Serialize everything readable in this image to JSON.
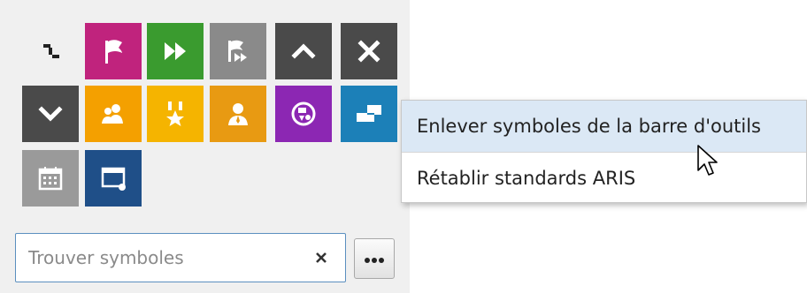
{
  "toolbar": {
    "tiles": [
      {
        "icon": "connector-icon",
        "color": "#f0f0f0"
      },
      {
        "icon": "flag-icon",
        "color": "#c0237d"
      },
      {
        "icon": "fast-forward-icon",
        "color": "#3a9b2f"
      },
      {
        "icon": "flag-forward-icon",
        "color": "#8a8a8a"
      },
      {
        "icon": "chevron-up-icon",
        "color": "#4a4a4a"
      },
      {
        "icon": "close-icon",
        "color": "#4a4a4a"
      },
      {
        "icon": "chevron-down-icon",
        "color": "#4a4a4a"
      },
      {
        "icon": "group-icon",
        "color": "#f4a000"
      },
      {
        "icon": "award-icon",
        "color": "#f5b400"
      },
      {
        "icon": "person-icon",
        "color": "#e89a12"
      },
      {
        "icon": "process-icon",
        "color": "#8c27b3"
      },
      {
        "icon": "tag-icon",
        "color": "#1c80b8"
      },
      {
        "icon": "calendar-icon",
        "color": "#9a9a9a"
      },
      {
        "icon": "window-icon",
        "color": "#1f4f88"
      }
    ]
  },
  "search": {
    "placeholder": "Trouver symboles",
    "value": ""
  },
  "more_button": {
    "icon": "ellipsis-icon"
  },
  "context_menu": {
    "items": [
      {
        "label": "Enlever symboles de la barre d'outils",
        "highlighted": true
      },
      {
        "label": "Rétablir standards ARIS",
        "highlighted": false
      }
    ]
  }
}
